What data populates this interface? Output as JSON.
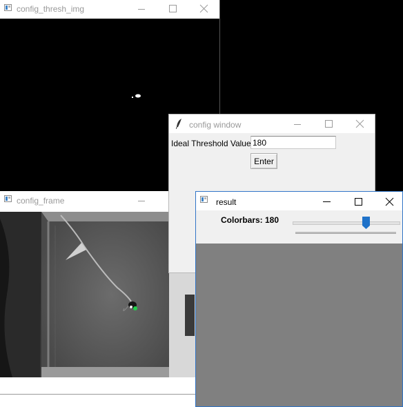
{
  "windows": {
    "thresh": {
      "title": "config_thresh_img"
    },
    "frame": {
      "title": "config_frame"
    },
    "config": {
      "title": "config window",
      "threshold_label": "Ideal Threshold Value",
      "threshold_value": "180",
      "enter_label": "Enter"
    },
    "result": {
      "title": "result",
      "colorbars_label": "Colorbars: 180",
      "slider": {
        "value": 180,
        "min": 0,
        "max": 255
      },
      "accent": "#1f72c9"
    }
  },
  "icons": {
    "app": "window-app-icon",
    "feather": "feather-icon",
    "minimize": "minimize-icon",
    "maximize": "maximize-icon",
    "close": "close-icon"
  }
}
